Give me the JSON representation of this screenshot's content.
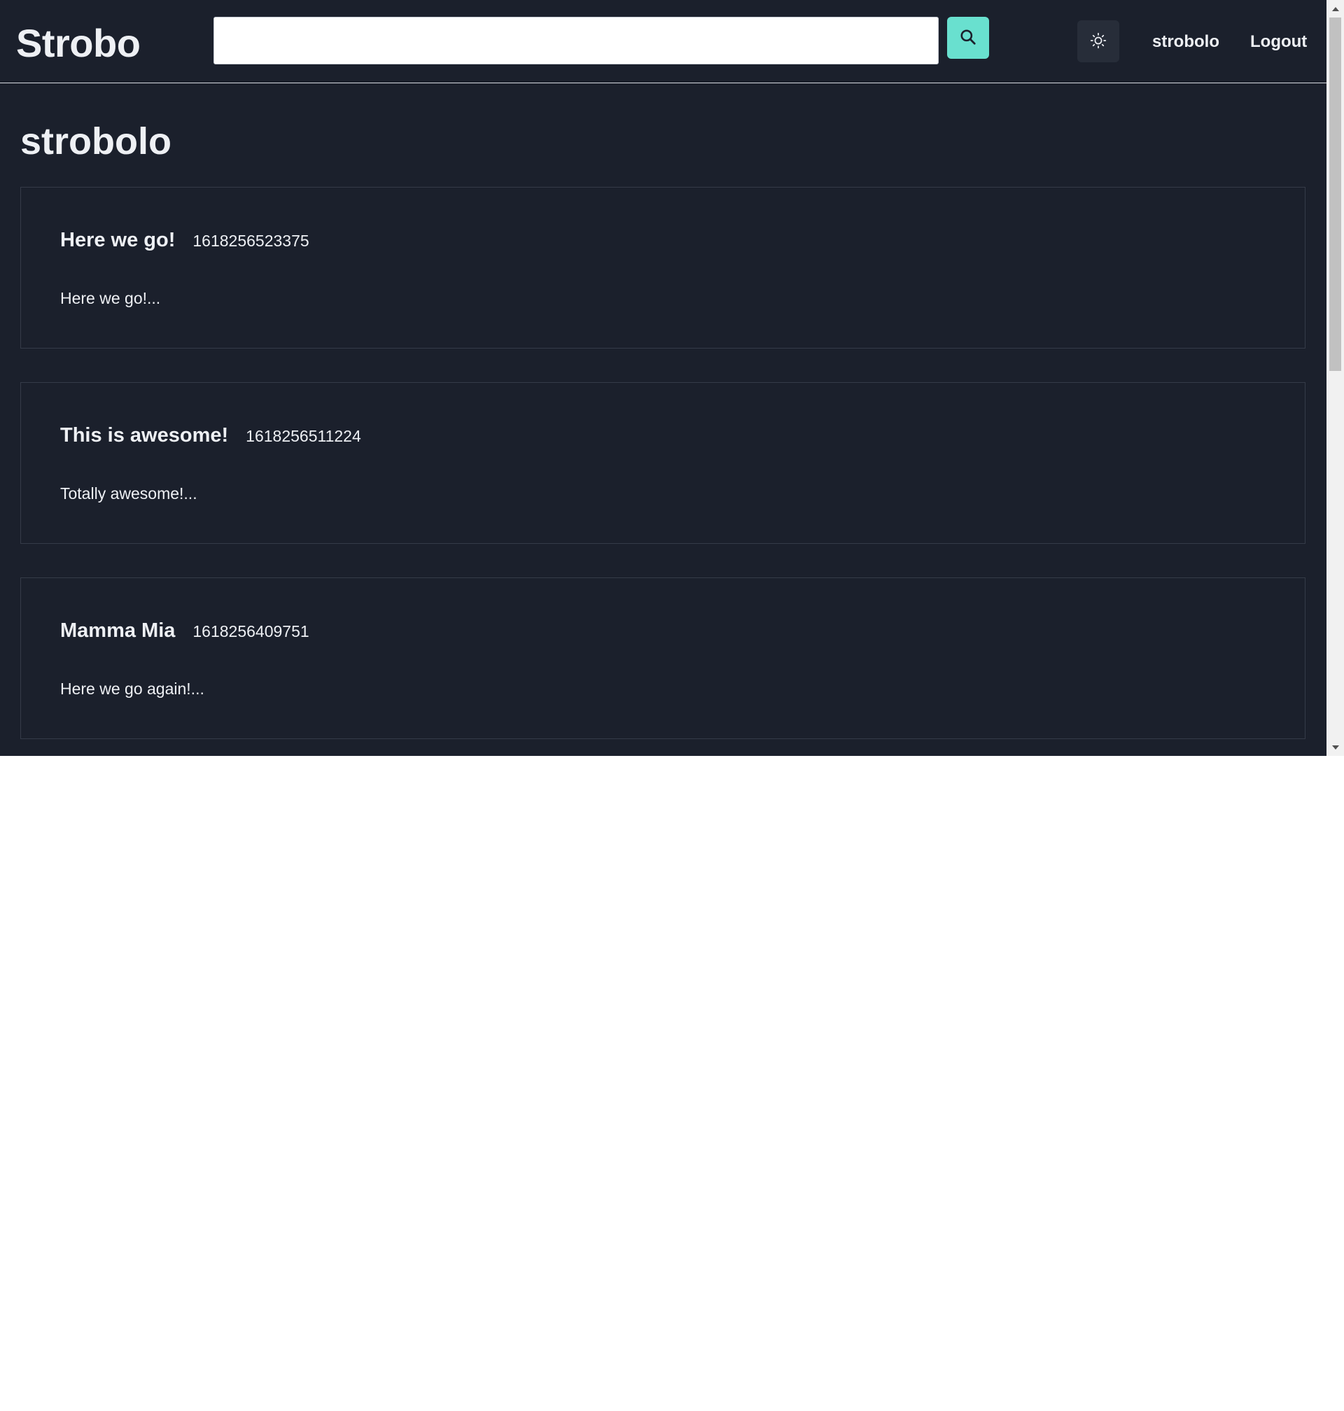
{
  "navbar": {
    "brand": "Strobo",
    "search_value": "",
    "search_icon": "search-icon",
    "theme_icon": "sun-icon",
    "user_link": "strobolo",
    "logout_link": "Logout"
  },
  "page": {
    "title": "strobolo"
  },
  "posts": [
    {
      "title": "Here we go!",
      "timestamp": "1618256523375",
      "excerpt": "Here we go!..."
    },
    {
      "title": "This is awesome!",
      "timestamp": "1618256511224",
      "excerpt": "Totally awesome!..."
    },
    {
      "title": "Mamma Mia",
      "timestamp": "1618256409751",
      "excerpt": "Here we go again!..."
    }
  ],
  "colors": {
    "background": "#1b202c",
    "accent": "#69e0cf",
    "text": "#eef0f4",
    "card_border": "#353b48"
  }
}
